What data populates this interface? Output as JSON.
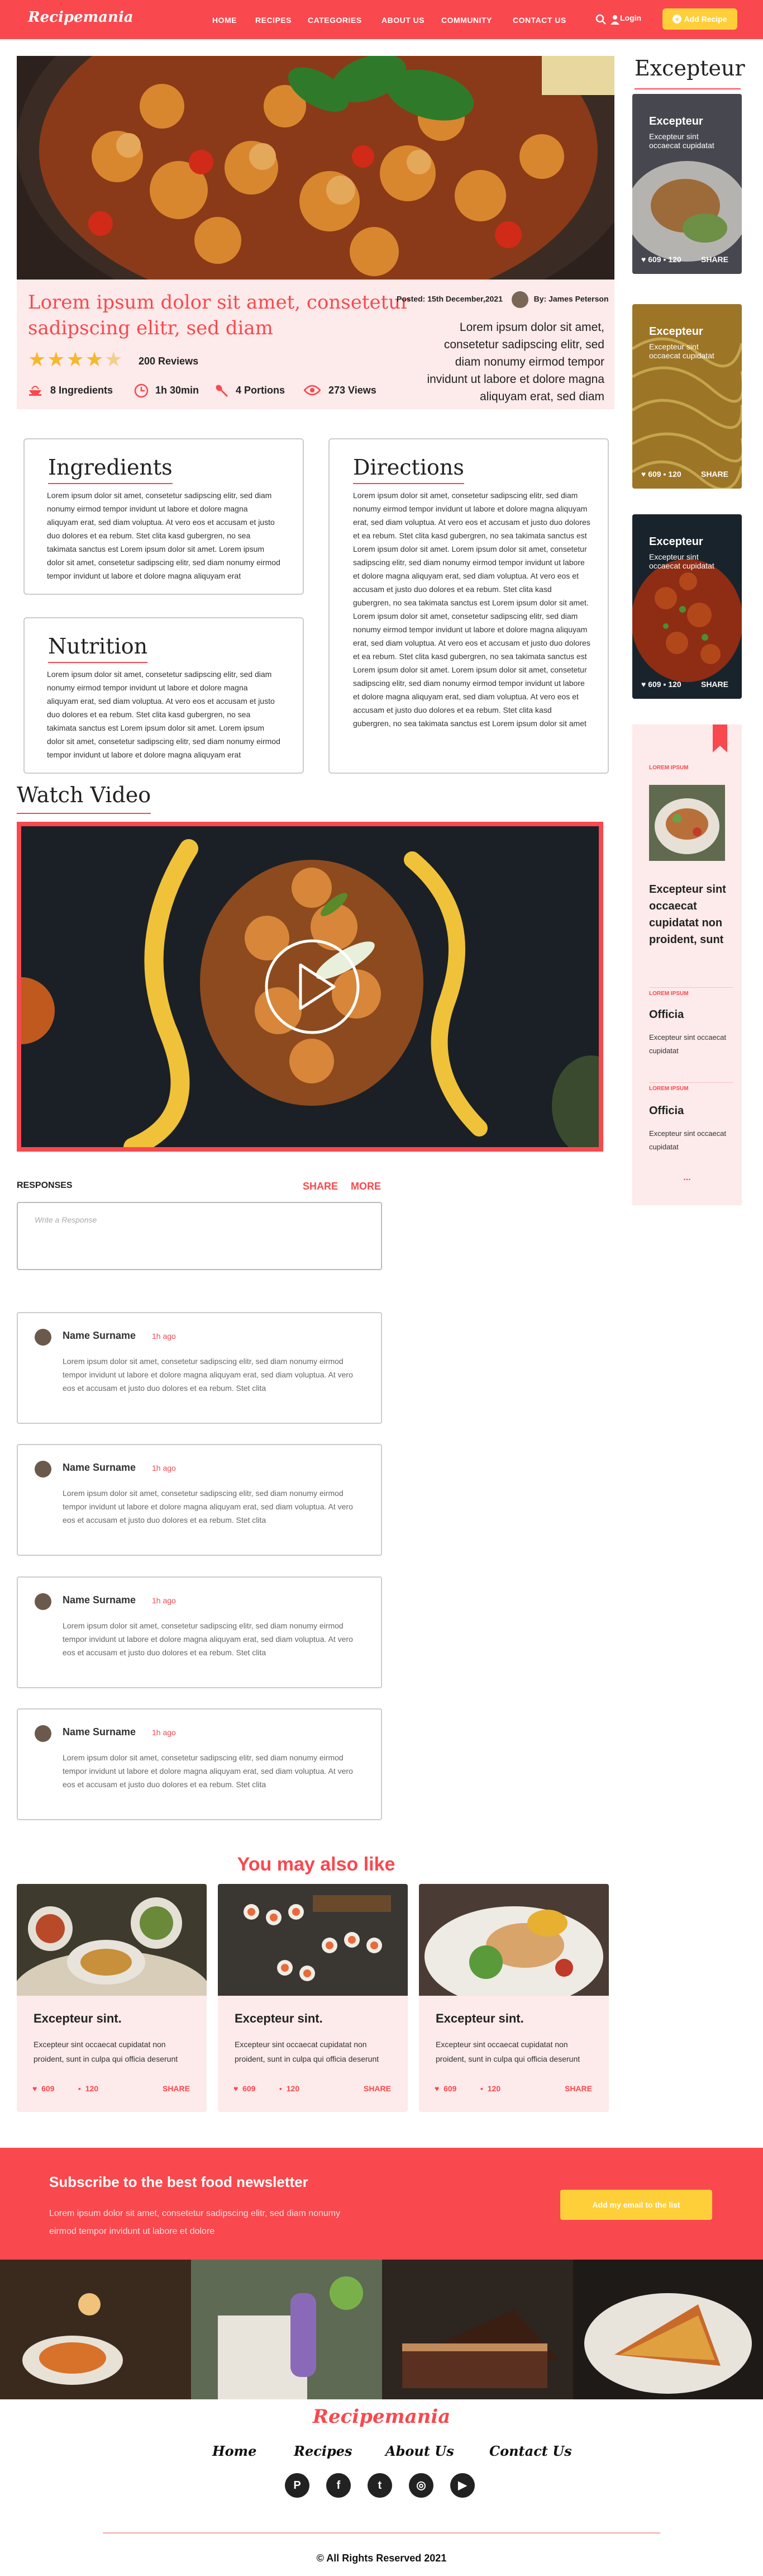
{
  "brand": {
    "name": "Recipemania",
    "accent": "#f9484e",
    "yellow": "#ffcf3a",
    "pink": "#fdeaea"
  },
  "nav": {
    "items": [
      {
        "label": "HOME"
      },
      {
        "label": "RECIPES"
      },
      {
        "label": "CATEGORIES"
      },
      {
        "label": "ABOUT US"
      },
      {
        "label": "COMMUNITY"
      },
      {
        "label": "CONTACT US"
      }
    ],
    "search_icon": "search-icon",
    "login_label": "Login",
    "add_recipe_label": "Add Recipe"
  },
  "hero": {
    "title": "Lorem ipsum dolor sit amet, consetetur sadipscing elitr, sed diam",
    "posted": "Posted: 15th December,2021",
    "author": "By: James Peterson",
    "description": "Lorem ipsum dolor sit amet, consetetur sadipscing elitr, sed diam nonumy eirmod tempor invidunt ut labore et dolore magna aliquyam erat, sed diam",
    "rating": 4.5,
    "reviews": "200 Reviews",
    "stats": [
      {
        "icon": "bowl-icon",
        "label": "8 Ingredients"
      },
      {
        "icon": "clock-icon",
        "label": "1h 30min"
      },
      {
        "icon": "spoon-icon",
        "label": "4 Portions"
      },
      {
        "icon": "eye-icon",
        "label": "273 Views"
      }
    ]
  },
  "ingredients": {
    "title": "Ingredients",
    "text": "Lorem ipsum dolor sit amet, consetetur sadipscing elitr, sed diam nonumy eirmod tempor invidunt ut labore et dolore magna aliquyam erat, sed diam voluptua. At vero eos et accusam et justo duo dolores et ea rebum. Stet clita kasd gubergren, no sea takimata sanctus est Lorem ipsum dolor sit amet. Lorem ipsum dolor sit amet, consetetur sadipscing elitr, sed diam nonumy eirmod tempor invidunt ut labore et dolore magna aliquyam erat"
  },
  "nutrition": {
    "title": "Nutrition",
    "text": "Lorem ipsum dolor sit amet, consetetur sadipscing elitr, sed diam nonumy eirmod tempor invidunt ut labore et dolore magna aliquyam erat, sed diam voluptua. At vero eos et accusam et justo duo dolores et ea rebum. Stet clita kasd gubergren, no sea takimata sanctus est Lorem ipsum dolor sit amet. Lorem ipsum dolor sit amet, consetetur sadipscing elitr, sed diam nonumy eirmod tempor invidunt ut labore et dolore magna aliquyam erat"
  },
  "directions": {
    "title": "Directions",
    "text": "Lorem ipsum dolor sit amet, consetetur sadipscing elitr, sed diam nonumy eirmod tempor invidunt ut labore et dolore magna aliquyam erat, sed diam voluptua. At vero eos et accusam et justo duo dolores et ea rebum. Stet clita kasd gubergren, no sea takimata sanctus est Lorem ipsum dolor sit amet. Lorem ipsum dolor sit amet, consetetur sadipscing elitr, sed diam nonumy eirmod tempor invidunt ut labore et dolore magna aliquyam erat, sed diam voluptua. At vero eos et accusam et justo duo dolores et ea rebum. Stet clita kasd gubergren, no sea takimata sanctus est Lorem ipsum dolor sit amet. Lorem ipsum dolor sit amet, consetetur sadipscing elitr, sed diam nonumy eirmod tempor invidunt ut labore et dolore magna aliquyam erat, sed diam voluptua. At vero eos et accusam et justo duo dolores et ea rebum. Stet clita kasd gubergren, no sea takimata sanctus est Lorem ipsum dolor sit amet. Lorem ipsum dolor sit amet, consetetur sadipscing elitr, sed diam nonumy eirmod tempor invidunt ut labore et dolore magna aliquyam erat, sed diam voluptua. At vero eos et accusam et justo duo dolores et ea rebum. Stet clita kasd gubergren, no sea takimata sanctus est Lorem ipsum dolor sit amet"
  },
  "sidebar": {
    "title": "Excepteur",
    "cards": [
      {
        "title": "Excepteur",
        "subtitle": "Excepteur sint occaecat cupidatat",
        "likes": "609",
        "comments": "120",
        "share": "SHARE"
      },
      {
        "title": "Excepteur",
        "subtitle": "Excepteur sint occaecat cupidatat",
        "likes": "609",
        "comments": "120",
        "share": "SHARE"
      },
      {
        "title": "Excepteur",
        "subtitle": "Excepteur sint occaecat cupidatat",
        "likes": "609",
        "comments": "120",
        "share": "SHARE"
      }
    ],
    "list": {
      "items": [
        {
          "tag": "LOREM IPSUM",
          "title": "Excepteur sint occaecat cupidatat non proident, sunt"
        },
        {
          "tag": "LOREM IPSUM",
          "title": "Officia",
          "text": "Excepteur sint occaecat cupidatat"
        },
        {
          "tag": "LOREM IPSUM",
          "title": "Officia",
          "text": "Excepteur sint occaecat cupidatat"
        }
      ],
      "more": "..."
    }
  },
  "video": {
    "title": "Watch Video",
    "play_icon": "play-icon"
  },
  "responses": {
    "heading": "RESPONSES",
    "share": "SHARE",
    "more": "MORE",
    "placeholder": "Write a Response",
    "comments": [
      {
        "name": "Name Surname",
        "time": "1h ago",
        "text": "Lorem ipsum dolor sit amet, consetetur sadipscing elitr, sed diam nonumy eirmod tempor invidunt ut labore et dolore magna aliquyam erat, sed diam voluptua. At vero eos et accusam et justo duo dolores et ea rebum. Stet clita"
      },
      {
        "name": "Name Surname",
        "time": "1h ago",
        "text": "Lorem ipsum dolor sit amet, consetetur sadipscing elitr, sed diam nonumy eirmod tempor invidunt ut labore et dolore magna aliquyam erat, sed diam voluptua. At vero eos et accusam et justo duo dolores et ea rebum. Stet clita"
      },
      {
        "name": "Name Surname",
        "time": "1h ago",
        "text": "Lorem ipsum dolor sit amet, consetetur sadipscing elitr, sed diam nonumy eirmod tempor invidunt ut labore et dolore magna aliquyam erat, sed diam voluptua. At vero eos et accusam et justo duo dolores et ea rebum. Stet clita"
      },
      {
        "name": "Name Surname",
        "time": "1h ago",
        "text": "Lorem ipsum dolor sit amet, consetetur sadipscing elitr, sed diam nonumy eirmod tempor invidunt ut labore et dolore magna aliquyam erat, sed diam voluptua. At vero eos et accusam et justo duo dolores et ea rebum. Stet clita"
      }
    ]
  },
  "also_like": {
    "title": "You may also like",
    "cards": [
      {
        "title": "Excepteur sint.",
        "text": "Excepteur sint occaecat cupidatat non proident, sunt in culpa qui officia deserunt",
        "likes": "609",
        "comments": "120",
        "share": "SHARE"
      },
      {
        "title": "Excepteur sint.",
        "text": "Excepteur sint occaecat cupidatat non proident, sunt in culpa qui officia deserunt",
        "likes": "609",
        "comments": "120",
        "share": "SHARE"
      },
      {
        "title": "Excepteur sint.",
        "text": "Excepteur sint occaecat cupidatat non proident, sunt in culpa qui officia deserunt",
        "likes": "609",
        "comments": "120",
        "share": "SHARE"
      }
    ]
  },
  "newsletter": {
    "title": "Subscribe to the best food newsletter",
    "text": "Lorem ipsum dolor sit amet, consetetur sadipscing elitr, sed diam nonumy eirmod tempor invidunt ut labore et dolore",
    "button": "Add my email to the list"
  },
  "footer": {
    "logo": "Recipemania",
    "links": [
      "Home",
      "Recipes",
      "About Us",
      "Contact Us"
    ],
    "social": [
      "pinterest-icon",
      "facebook-icon",
      "twitter-icon",
      "instagram-icon",
      "youtube-icon"
    ],
    "copyright": "© All Rights Reserved 2021"
  }
}
